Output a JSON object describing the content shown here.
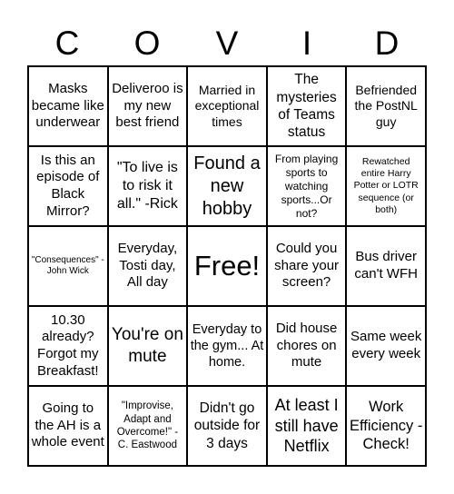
{
  "header": [
    "C",
    "O",
    "V",
    "I",
    "D"
  ],
  "cells": [
    {
      "text": "Masks became like underwear",
      "size": 15
    },
    {
      "text": "Deliveroo is my new best friend",
      "size": 15
    },
    {
      "text": "Married in exceptional times",
      "size": 14
    },
    {
      "text": "The mysteries of Teams status",
      "size": 15.5
    },
    {
      "text": "Befriended the PostNL guy",
      "size": 14
    },
    {
      "text": "Is this an episode of Black Mirror?",
      "size": 15
    },
    {
      "text": "\"To live is to risk it all.\" -Rick",
      "size": 16
    },
    {
      "text": "Found a new hobby",
      "size": 20
    },
    {
      "text": "From playing sports to watching sports...Or not?",
      "size": 12
    },
    {
      "text": "Rewatched entire Harry Potter or LOTR sequence (or both)",
      "size": 10.5
    },
    {
      "text": "\"Consequences\" - John Wick",
      "size": 10
    },
    {
      "text": "Everyday, Tosti day, All day",
      "size": 15
    },
    {
      "text": "Free!",
      "size": 31
    },
    {
      "text": "Could you share your screen?",
      "size": 15
    },
    {
      "text": "Bus driver can't WFH",
      "size": 15
    },
    {
      "text": "10.30 already? Forgot my Breakfast!",
      "size": 15
    },
    {
      "text": "You're on mute",
      "size": 19
    },
    {
      "text": "Everyday to the gym... At home.",
      "size": 14.5
    },
    {
      "text": "Did house chores on mute",
      "size": 15
    },
    {
      "text": "Same week every week",
      "size": 15
    },
    {
      "text": "Going to the AH is a whole event",
      "size": 15
    },
    {
      "text": "\"Improvise, Adapt and Overcome!\" - C. Eastwood",
      "size": 11.5
    },
    {
      "text": "Didn't go outside for 3 days",
      "size": 15.5
    },
    {
      "text": "At least I still have Netflix",
      "size": 18
    },
    {
      "text": "Work Efficiency - Check!",
      "size": 16.5
    }
  ]
}
